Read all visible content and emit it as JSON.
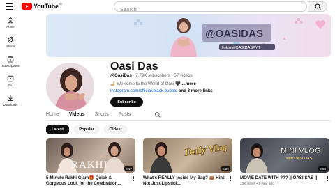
{
  "header": {
    "logo_text": "YouTube",
    "logo_country": "IN",
    "search_placeholder": "Search"
  },
  "sidebar": {
    "items": [
      {
        "label": "Home",
        "icon": "home-icon"
      },
      {
        "label": "Shorts",
        "icon": "shorts-icon"
      },
      {
        "label": "Subscriptions",
        "icon": "subscriptions-icon"
      },
      {
        "label": "You",
        "icon": "you-icon"
      },
      {
        "label": "Downloads",
        "icon": "download-icon"
      }
    ]
  },
  "banner": {
    "handle": "@OASIDAS",
    "link": "link.me/OASIDASPYT"
  },
  "channel": {
    "name": "Oasi Das",
    "handle": "@OasiDas",
    "subscribers": "7.79K subscribers",
    "videos": "57 videos",
    "meta_separator": "‧",
    "description": "🤳 Welcome to the World of Oasi 🖤",
    "more": "...more",
    "link": "instagram.com/official.black.bubble",
    "link_suffix": " and 3 more links",
    "subscribe_label": "Subscribe"
  },
  "tabs": [
    {
      "label": "Home",
      "active": false
    },
    {
      "label": "Videos",
      "active": true
    },
    {
      "label": "Shorts",
      "active": false
    },
    {
      "label": "Posts",
      "active": false
    }
  ],
  "filters": [
    {
      "label": "Latest",
      "active": true
    },
    {
      "label": "Popular",
      "active": false
    },
    {
      "label": "Oldest",
      "active": false
    }
  ],
  "videos": [
    {
      "title": "5-Minute Rakhi Glam🎁 Quick & Gorgeous Look for the Celebration...",
      "duration": "4:17",
      "thumb_text": "RAKHI",
      "meta": ""
    },
    {
      "title": "What's REALLY Inside My Bag? 👜 Hint: Not Just Lipstick...",
      "duration": "5:29",
      "thumb_text": "Daily Vlog",
      "meta": ""
    },
    {
      "title": "MOVIE DATE WITH ??? || OASI SAS ||",
      "duration": "3:03",
      "thumb_text": "MINI VLOG",
      "thumb_sub": "with OASI DAS",
      "meta": "23K views • 1 year ago"
    }
  ],
  "colors": {
    "brand_red": "#ff0000",
    "link_blue": "#065fd4",
    "text_primary": "#0f0f0f",
    "text_secondary": "#606060"
  }
}
